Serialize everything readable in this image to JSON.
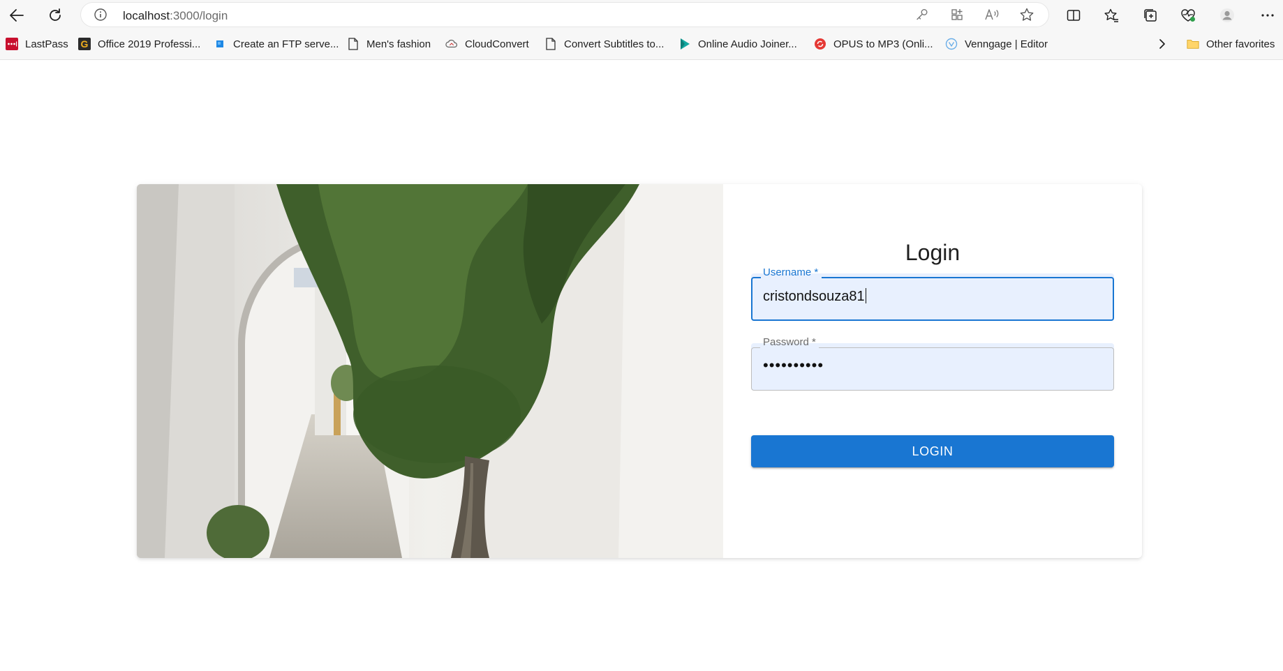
{
  "browser": {
    "url_host": "localhost",
    "url_path": ":3000/login"
  },
  "bookmarks": [
    {
      "label": "LastPass",
      "icon": "lastpass-icon"
    },
    {
      "label": "Office 2019 Professi...",
      "icon": "g-letter-icon"
    },
    {
      "label": "Create an FTP serve...",
      "icon": "blue-square-icon"
    },
    {
      "label": "Men's fashion",
      "icon": "page-icon"
    },
    {
      "label": "CloudConvert",
      "icon": "cloud-icon"
    },
    {
      "label": "Convert Subtitles to...",
      "icon": "page-icon"
    },
    {
      "label": "Online Audio Joiner...",
      "icon": "play-icon"
    },
    {
      "label": "OPUS to MP3 (Onli...",
      "icon": "red-circle-icon"
    },
    {
      "label": "Venngage | Editor",
      "icon": "venngage-icon"
    }
  ],
  "bookmarks_other": "Other favorites",
  "login": {
    "title": "Login",
    "username_label": "Username *",
    "username_value": "cristondsouza81",
    "password_label": "Password *",
    "password_value": "••••••••••",
    "button_label": "LOGIN"
  },
  "colors": {
    "primary": "#1976d2",
    "input_bg": "#e8f0fe"
  }
}
